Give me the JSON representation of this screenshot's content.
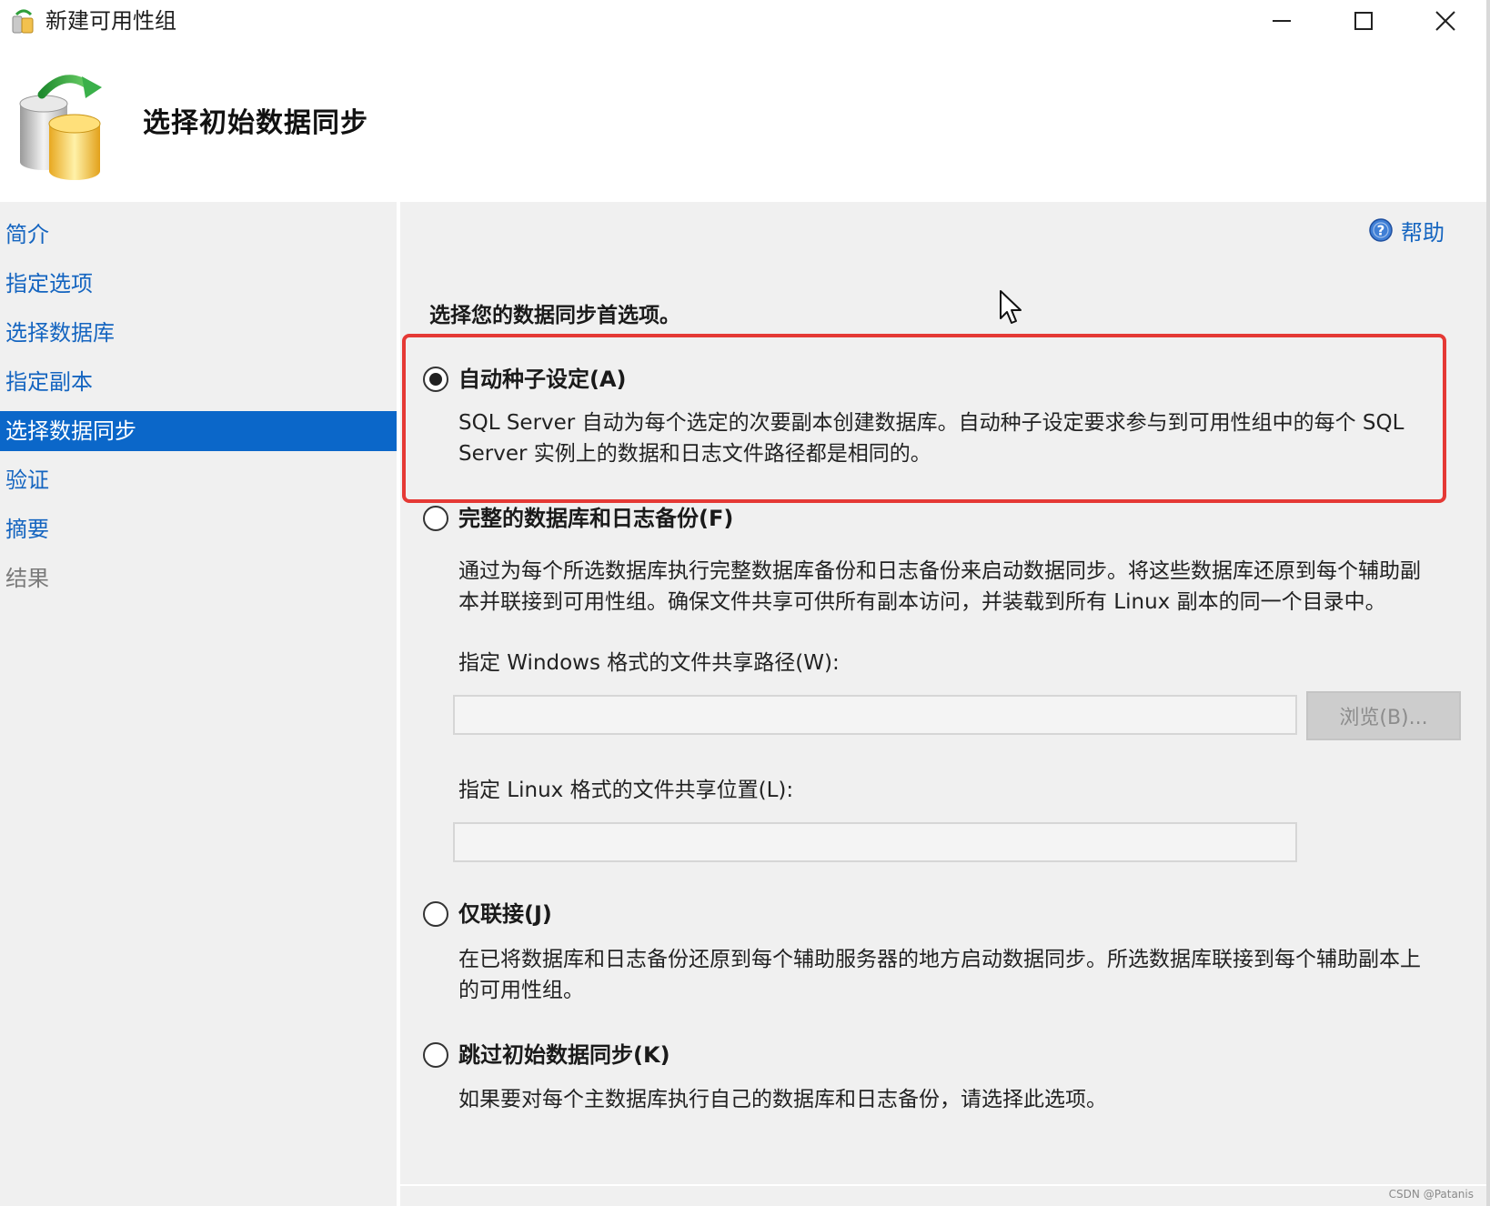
{
  "window": {
    "title": "新建可用性组",
    "app_icon": "availability-group-icon",
    "controls": [
      "minimize-icon",
      "maximize-icon",
      "close-icon"
    ]
  },
  "header": {
    "title": "选择初始数据同步",
    "icon": "database-sync-icon"
  },
  "nav": {
    "items": [
      {
        "label": "简介",
        "state": "normal"
      },
      {
        "label": "指定选项",
        "state": "normal"
      },
      {
        "label": "选择数据库",
        "state": "normal"
      },
      {
        "label": "指定副本",
        "state": "normal"
      },
      {
        "label": "选择数据同步",
        "state": "selected"
      },
      {
        "label": "验证",
        "state": "normal"
      },
      {
        "label": "摘要",
        "state": "normal"
      },
      {
        "label": "结果",
        "state": "disabled"
      }
    ]
  },
  "help": {
    "label": "帮助",
    "icon": "help-icon"
  },
  "content": {
    "prompt": "选择您的数据同步首选项。",
    "options": [
      {
        "label": "自动种子设定(A)",
        "checked": true,
        "description": "SQL Server 自动为每个选定的次要副本创建数据库。自动种子设定要求参与到可用性组中的每个 SQL Server 实例上的数据和日志文件路径都是相同的。"
      },
      {
        "label": "完整的数据库和日志备份(F)",
        "checked": false,
        "description": "通过为每个所选数据库执行完整数据库备份和日志备份来启动数据同步。将这些数据库还原到每个辅助副本并联接到可用性组。确保文件共享可供所有副本访问，并装载到所有 Linux 副本的同一个目录中。"
      },
      {
        "label": "仅联接(J)",
        "checked": false,
        "description": "在已将数据库和日志备份还原到每个辅助服务器的地方启动数据同步。所选数据库联接到每个辅助副本上的可用性组。"
      },
      {
        "label": "跳过初始数据同步(K)",
        "checked": false,
        "description": "如果要对每个主数据库执行自己的数据库和日志备份，请选择此选项。"
      }
    ],
    "windows_share": {
      "label": "指定 Windows 格式的文件共享路径(W):",
      "value": "",
      "enabled": false
    },
    "linux_share": {
      "label": "指定 Linux 格式的文件共享位置(L):",
      "value": "",
      "enabled": false
    },
    "browse_button": {
      "label": "浏览(B)...",
      "enabled": false
    }
  },
  "watermark": "CSDN @Patanis",
  "colors": {
    "accent": "#0b67c9",
    "link": "#1565c0",
    "panel_bg": "#f0f0f0",
    "highlight_border": "#e53935"
  }
}
